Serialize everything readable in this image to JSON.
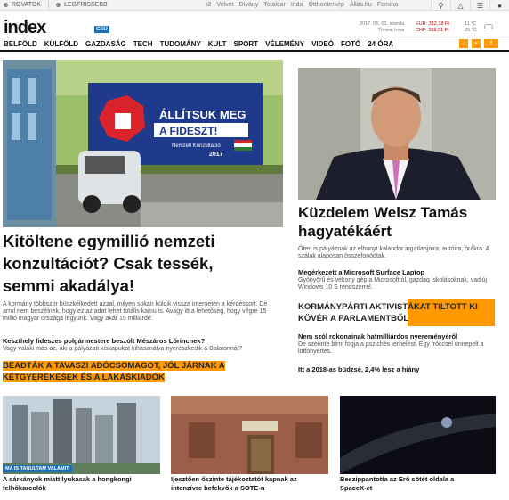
{
  "topbar": {
    "rovatok": "ROVATOK",
    "legfrissebb": "LEGFRISSEBB",
    "sites": [
      "i2",
      "Velvet",
      "Dívány",
      "Totalcar",
      "Inda",
      "Otthonterkép",
      "Állás.hu",
      "Femina"
    ]
  },
  "header": {
    "logo": "index",
    "logo_tag": "CEU",
    "date": "2017. 05. 03. szerda",
    "namesday": "Tímea, Irma",
    "rate1": "EUR: 312,18 Ft",
    "rate2": "CHF: 288,51 Ft",
    "temp1": "11 °C",
    "temp2": "20 °C"
  },
  "nav": {
    "items": [
      "BELFÖLD",
      "KÜLFÖLD",
      "GAZDASÁG",
      "TECH",
      "TUDOMÁNY",
      "KULT",
      "SPORT",
      "VÉLEMÉNY",
      "VIDEÓ",
      "FOTÓ",
      "24 ÓRA"
    ]
  },
  "billboard": {
    "line1": "ÁLLÍTSUK MEG",
    "line2": "A FIDESZT!",
    "line3": "Nemzeti Konzultáció",
    "line4": "2017"
  },
  "main": {
    "headline": "Kitöltene egymillió nemzeti konzultációt? Csak tessék, semmi akadálya!",
    "lead": "A kormány többször büszkélkedett azzal, milyen sokan küldik vissza interneten a kérdéssort. De arról nem beszélnek, hogy ez az adat lehet totális kamu is. Avagy itt a lehetőség, hogy végre 15 millió magyar országa legyünk. Vagy akár 15 milliárdé.",
    "sub1_title": "Keszthely fideszes polgármestere beszólt Mészáros Lőrincnek?",
    "sub1_text": "Vagy valaki más az, aki a pályázati kiskapukat kihasználva nyerészkedik a Balatonnál?",
    "promo": "BEADTÁK A TAVASZI ADÓCSOMAGOT, JÓL JÁRNAK A KÉTGYEREKESEK ÉS A LAKÁSKIADÓK"
  },
  "right": {
    "headline": "Küzdelem Welsz Tamás hagyatékáért",
    "text": "Őten is pályáznak az elhunyt kalandor ingatlanjaira, autóira, órákra. A szálak alaposan összefonódtak.",
    "s1_title": "Megérkezett a Microsoft Surface Laptop",
    "s1_text": "Gyönyörű és vékony gép a Microsofttól, gazdag iskolásoknak, vadiúj Windows 10 S rendszerrel.",
    "promo": "KORMÁNYPÁRTI AKTIVISTÁKAT TILTOTT KI KÖVÉR A PARLAMENTBŐL",
    "s2_title": "Nem szól rokonainak hatmilliárdos nyereményéről",
    "s2_text": "De szerinte bírni fogja a pszichés terhelést. Egy fröccsel ünnepelt a lottónyertes.",
    "s3_title": "Itt a 2018-as büdzsé, 2,4% lesz a hiány"
  },
  "bottom": {
    "badge": "MA IS TANULTAM VALAMIT",
    "cap1": "A sárkányok miatt lyukasak a hongkongi felhőkarcolók",
    "cap2": "Ijesztően őszinte tájékoztatót kapnak az intenzívre befekvők a SOTE-n",
    "cap3": "Beszippantotta az Erő sötét oldala a SpaceX-et"
  },
  "colors": {
    "accent": "#ff9900",
    "brand_blue": "#1b6fb8"
  }
}
